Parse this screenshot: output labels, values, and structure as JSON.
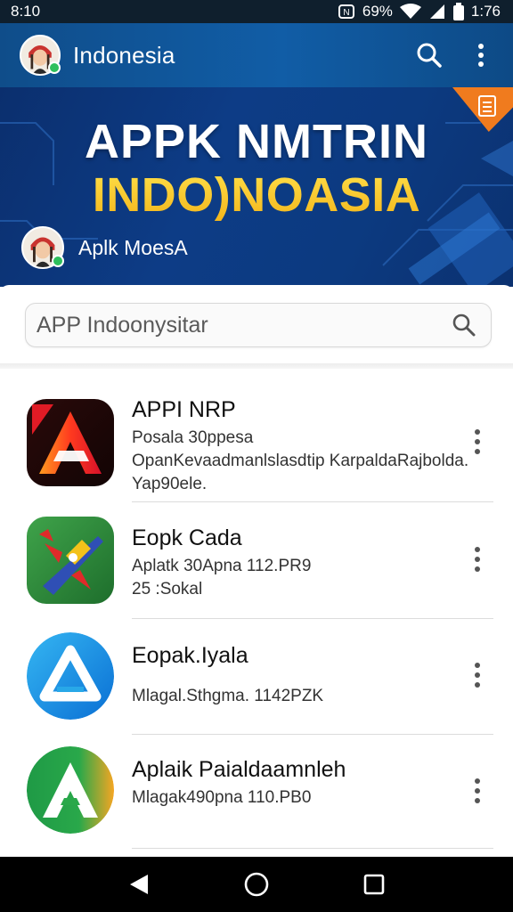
{
  "status_bar": {
    "time": "8:10",
    "battery": "69%",
    "clock_right": "1:76"
  },
  "app_bar": {
    "title": "Indonesia",
    "search_icon": "search-icon",
    "more_icon": "more-vert-icon"
  },
  "banner": {
    "title": "APPK NMTRIN",
    "subtitle": "INDO)NOASIA",
    "user_name": "Aplk MoesA"
  },
  "search": {
    "placeholder": "APP Indoonysitar"
  },
  "apps": [
    {
      "name": "APPI NRP",
      "line1": "Posala 30ppesa",
      "line2": "OpanKevaadmanlslasdtip KarpaldaRajbolda.",
      "line3": "Yap90ele."
    },
    {
      "name": "Eopk Cada",
      "line1": "Aplatk 30Apna 112.PR9",
      "line2": "25 :Sokal",
      "line3": ""
    },
    {
      "name": "Eopak.Iyala",
      "line1": "",
      "line2": "Mlagal.Sthgma. 1142PZK",
      "line3": ""
    },
    {
      "name": "Aplaik Paialdaamnleh",
      "line1": "Mlagak490pna 110.PB0",
      "line2": "",
      "line3": ""
    }
  ],
  "colors": {
    "app_bar": "#115da6",
    "banner_dark": "#0b2f6e",
    "banner_accent": "#f3b51a",
    "badge": "#f07b1e",
    "online": "#2ebf5c"
  }
}
